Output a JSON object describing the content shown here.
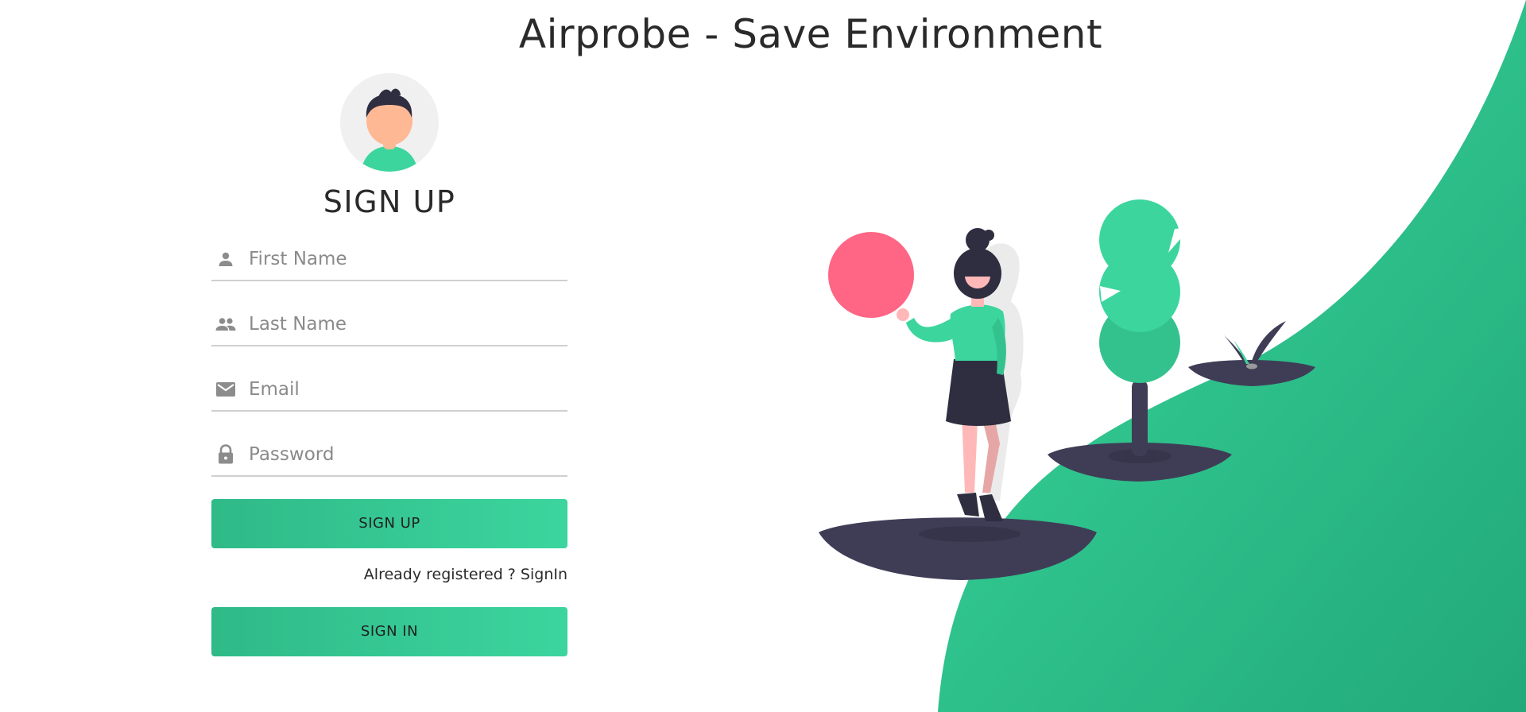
{
  "page": {
    "title": "Airprobe - Save Environment"
  },
  "form": {
    "heading": "SIGN UP",
    "fields": [
      {
        "icon": "person-icon",
        "placeholder": "First Name",
        "value": ""
      },
      {
        "icon": "people-icon",
        "placeholder": "Last Name",
        "value": ""
      },
      {
        "icon": "mail-icon",
        "placeholder": "Email",
        "value": ""
      },
      {
        "icon": "lock-icon",
        "placeholder": "Password",
        "value": ""
      }
    ],
    "signup_label": "SIGN UP",
    "already_registered": "Already registered ? SignIn",
    "signin_label": "SIGN IN"
  },
  "colors": {
    "accent": "#3cd59e",
    "accent_dark": "#2fba88",
    "ball": "#ff6584",
    "ink": "#3f3d56"
  }
}
